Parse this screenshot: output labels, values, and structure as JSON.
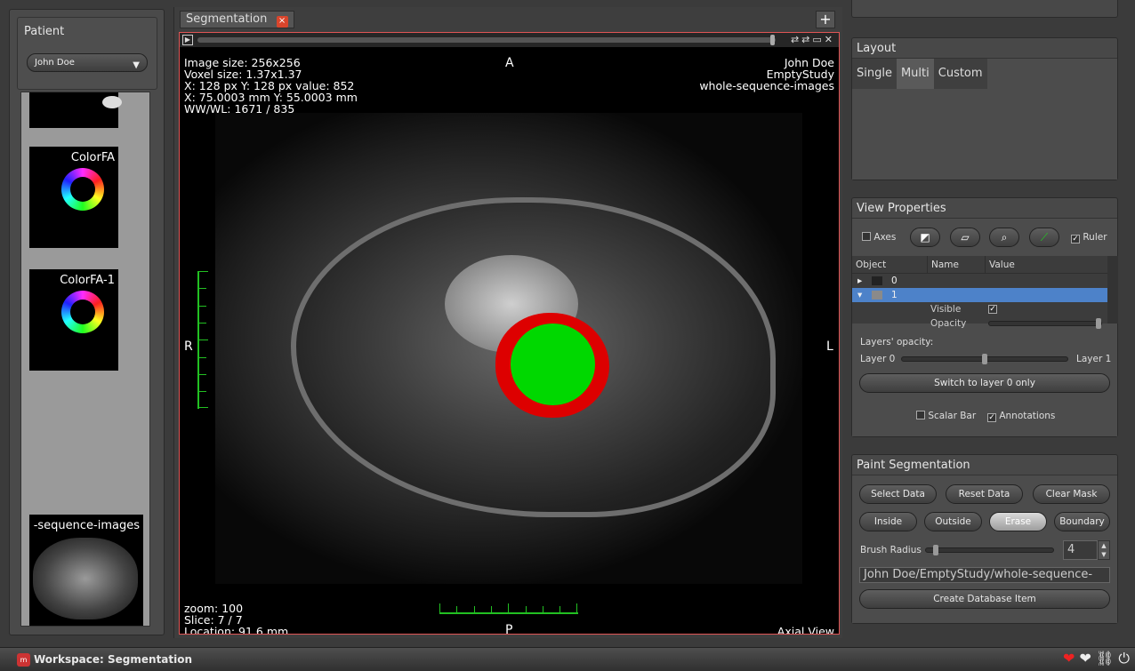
{
  "patient": {
    "title": "Patient",
    "selected": "John Doe"
  },
  "thumbnails": [
    {
      "label": "ColorFA"
    },
    {
      "label": "ColorFA-1"
    },
    {
      "label": "-sequence-images"
    }
  ],
  "segmentation_tab": {
    "label": "Segmentation",
    "close": "×",
    "add": "+"
  },
  "viewer": {
    "info_lines": [
      "Image size: 256x256",
      "Voxel size: 1.37x1.37",
      "X:  128 px Y:  128 px value:   852",
      "X: 75.0003 mm Y: 55.0003 mm",
      "WW/WL:  1671 / 835"
    ],
    "patient_lines": [
      "John Doe",
      "EmptyStudy",
      "whole-sequence-images"
    ],
    "orient_top": "A",
    "orient_left": "R",
    "orient_right": "L",
    "orient_bottom": "P",
    "zoom": "zoom:   100",
    "slice": "Slice: 7 / 7",
    "location": "Location: 91.6 mm",
    "view_name": "Axial View",
    "mask_colors": {
      "outer": "#dd0000",
      "inner": "#00d800"
    },
    "toolbar_icons": "⇄⇄▭✕"
  },
  "layout": {
    "title": "Layout",
    "tabs": [
      "Single",
      "Multi",
      "Custom"
    ],
    "active": "Multi"
  },
  "view_properties": {
    "title": "View Properties",
    "axes": "Axes",
    "ruler": "Ruler",
    "ruler_checked": true,
    "columns": [
      "Object",
      "Name",
      "Value"
    ],
    "rows": [
      {
        "arrow": "▸",
        "name": "0"
      },
      {
        "arrow": "▾",
        "name": "1"
      }
    ],
    "visible": "Visible",
    "opacity": "Opacity",
    "layers_opacity": "Layers' opacity:",
    "layer0": "Layer 0",
    "layer1": "Layer 1",
    "layer_blend": 0.5,
    "switch_button": "Switch to layer 0 only",
    "scalar_bar": "Scalar Bar",
    "annotations": "Annotations"
  },
  "paint": {
    "title": "Paint Segmentation",
    "buttons_row1": [
      "Select Data",
      "Reset Data",
      "Clear Mask"
    ],
    "buttons_row2": [
      "Inside",
      "Outside",
      "Erase",
      "Boundary"
    ],
    "active_button": "Erase",
    "brush_label": "Brush Radius",
    "brush_value": "4",
    "path": "John Doe/EmptyStudy/whole-sequence-",
    "create_button": "Create Database Item"
  },
  "status": {
    "workspace": "Workspace: Segmentation",
    "tray_icons": "❤ ⛓ ⏻"
  }
}
